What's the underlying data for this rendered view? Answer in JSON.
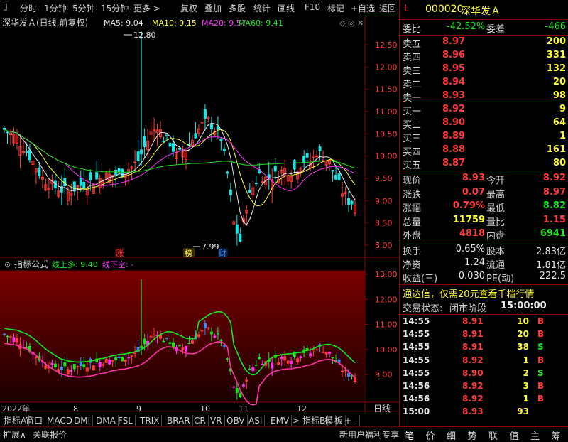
{
  "toolbar": {
    "left": [
      "分时",
      "1分钟",
      "5分钟",
      "15分钟",
      "更多 >"
    ],
    "right": [
      "复权",
      "叠加",
      "多股",
      "统计",
      "画线",
      "F10",
      "标记",
      "+自选",
      "返回"
    ]
  },
  "chart": {
    "header": {
      "name": "深华发Ａ(日线,前复权)",
      "ma5": "MA5: 9.04",
      "ma10": "MA10: 9.15",
      "ma20": "MA20: 9.57",
      "ma60": "MA60: 9.41"
    },
    "high_label": "12.80",
    "low_label": "7.99",
    "price_ticks": [
      "12.50",
      "12.00",
      "11.50",
      "11.00",
      "10.50",
      "10.00",
      "9.50",
      "9.00",
      "8.50",
      "8.00"
    ],
    "markers": [
      {
        "text": "涨",
        "color": "#ff3b3b"
      },
      {
        "text": "榜",
        "color": "#ffff33"
      },
      {
        "text": "财",
        "color": "#3b8bff"
      }
    ],
    "indicator_header": {
      "title": "指标公式",
      "up": "线上多: 9.40",
      "down": "线下空: -"
    },
    "indicator_ticks": [
      "13.00",
      "12.00",
      "11.00",
      "10.00",
      "9.00"
    ],
    "dates": [
      "2022年",
      "8",
      "9",
      "10",
      "11",
      "12"
    ],
    "date_right": "日线"
  },
  "chart_data": {
    "type": "candlestick",
    "ylim": [
      7.8,
      13.0
    ],
    "high": 12.8,
    "low": 7.99,
    "ma": {
      "ma5": 9.04,
      "ma10": 9.15,
      "ma20": 9.57,
      "ma60": 9.41
    }
  },
  "tabs": [
    "指标A",
    "窗口",
    "MACD",
    "DMI",
    "DMA",
    "FSL",
    "TRIX",
    "BRAR",
    "CR",
    "VR",
    "OBV",
    "ASI",
    "EMV",
    ">",
    "指标B",
    "模",
    "板",
    "+",
    "-"
  ],
  "bottom": {
    "left1": "扩展∧",
    "left2": "关联报价",
    "right": "新用户福利专享"
  },
  "panel": {
    "code_marker": "L",
    "code": "000020",
    "name": "深华发Ａ",
    "weibi_label": "委比",
    "weibi": "-42.52%",
    "weicha_label": "委差",
    "weicha": "-466",
    "asks": [
      {
        "label": "卖五",
        "price": "8.97",
        "vol": "200"
      },
      {
        "label": "卖四",
        "price": "8.96",
        "vol": "331"
      },
      {
        "label": "卖三",
        "price": "8.95",
        "vol": "132"
      },
      {
        "label": "卖二",
        "price": "8.94",
        "vol": "20"
      },
      {
        "label": "卖一",
        "price": "8.93",
        "vol": "98"
      }
    ],
    "bids": [
      {
        "label": "买一",
        "price": "8.92",
        "vol": "9"
      },
      {
        "label": "买二",
        "price": "8.90",
        "vol": "64"
      },
      {
        "label": "买三",
        "price": "8.89",
        "vol": "1"
      },
      {
        "label": "买四",
        "price": "8.88",
        "vol": "161"
      },
      {
        "label": "买五",
        "price": "8.87",
        "vol": "80"
      }
    ],
    "quote": [
      {
        "l1": "现价",
        "v1": "8.93",
        "c1": "red",
        "l2": "今开",
        "v2": "8.92",
        "c2": "red"
      },
      {
        "l1": "涨跌",
        "v1": "0.07",
        "c1": "red",
        "l2": "最高",
        "v2": "8.97",
        "c2": "red"
      },
      {
        "l1": "涨幅",
        "v1": "0.79%",
        "c1": "red",
        "l2": "最低",
        "v2": "8.82",
        "c2": "green"
      },
      {
        "l1": "总量",
        "v1": "11759",
        "c1": "yellow",
        "l2": "量比",
        "v2": "1.15",
        "c2": "red"
      },
      {
        "l1": "外盘",
        "v1": "4818",
        "c1": "red",
        "l2": "内盘",
        "v2": "6941",
        "c2": "green"
      }
    ],
    "finance": [
      {
        "l1": "换手",
        "v1": "0.65%",
        "l2": "股本",
        "v2": "2.83亿"
      },
      {
        "l1": "净资",
        "v1": "1.24",
        "l2": "流通",
        "v2": "1.81亿"
      },
      {
        "l1": "收益(三)",
        "v1": "0.030",
        "l2": "PE(动)",
        "v2": "222.5"
      }
    ],
    "promo": "通达信，仅需20元查看千档行情",
    "status_label": "交易状态:",
    "status": "闭市阶段",
    "status_time": "15:00:00",
    "ticks": [
      {
        "t": "14:55",
        "p": "8.91",
        "v": "10",
        "s": "B",
        "sc": "red"
      },
      {
        "t": "14:55",
        "p": "8.91",
        "v": "20",
        "s": "B",
        "sc": "red"
      },
      {
        "t": "14:55",
        "p": "8.91",
        "v": "38",
        "s": "S",
        "sc": "green"
      },
      {
        "t": "14:55",
        "p": "8.92",
        "v": "1",
        "s": "B",
        "sc": "red"
      },
      {
        "t": "14:55",
        "p": "8.90",
        "v": "2",
        "s": "S",
        "sc": "green"
      },
      {
        "t": "14:56",
        "p": "8.92",
        "v": "3",
        "s": "B",
        "sc": "red"
      },
      {
        "t": "14:56",
        "p": "8.92",
        "v": "1",
        "s": "B",
        "sc": "red"
      },
      {
        "t": "15:00",
        "p": "8.93",
        "v": "93",
        "s": "",
        "sc": "red"
      }
    ],
    "foot": [
      "笔",
      "价",
      "细",
      "势",
      "联",
      "值",
      "主",
      "筹"
    ]
  }
}
